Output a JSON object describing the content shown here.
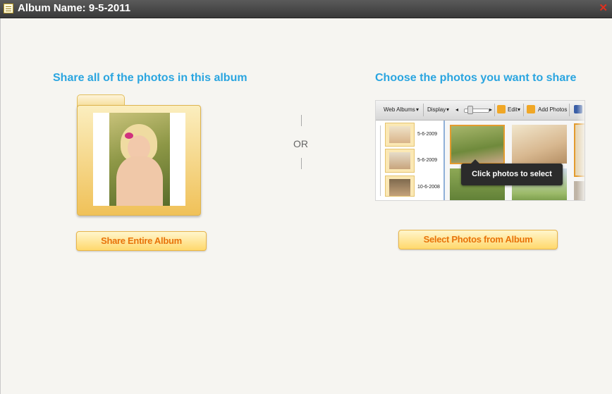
{
  "window": {
    "title": "Album Name: 9-5-2011",
    "app_icon": "notepad-icon",
    "close_icon": "close-icon",
    "close_glyph": "✕"
  },
  "left_panel": {
    "heading": "Share all of the photos in this album",
    "button_label": "Share Entire Album"
  },
  "divider": {
    "label": "OR"
  },
  "right_panel": {
    "heading": "Choose the photos you want to share",
    "button_label": "Select Photos from Album",
    "preview": {
      "toolbar": {
        "web_albums": "Web Albums",
        "display": "Display",
        "edit": "Edit",
        "add_photos": "Add Photos"
      },
      "album_dates": [
        "5-6-2009",
        "5-6-2009",
        "10-6-2008"
      ],
      "tooltip": "Click photos to select"
    }
  },
  "colors": {
    "heading": "#2aa5e0",
    "button_text": "#e8730a",
    "button_fill": "#ffd86c",
    "folder": "#f0c158"
  }
}
